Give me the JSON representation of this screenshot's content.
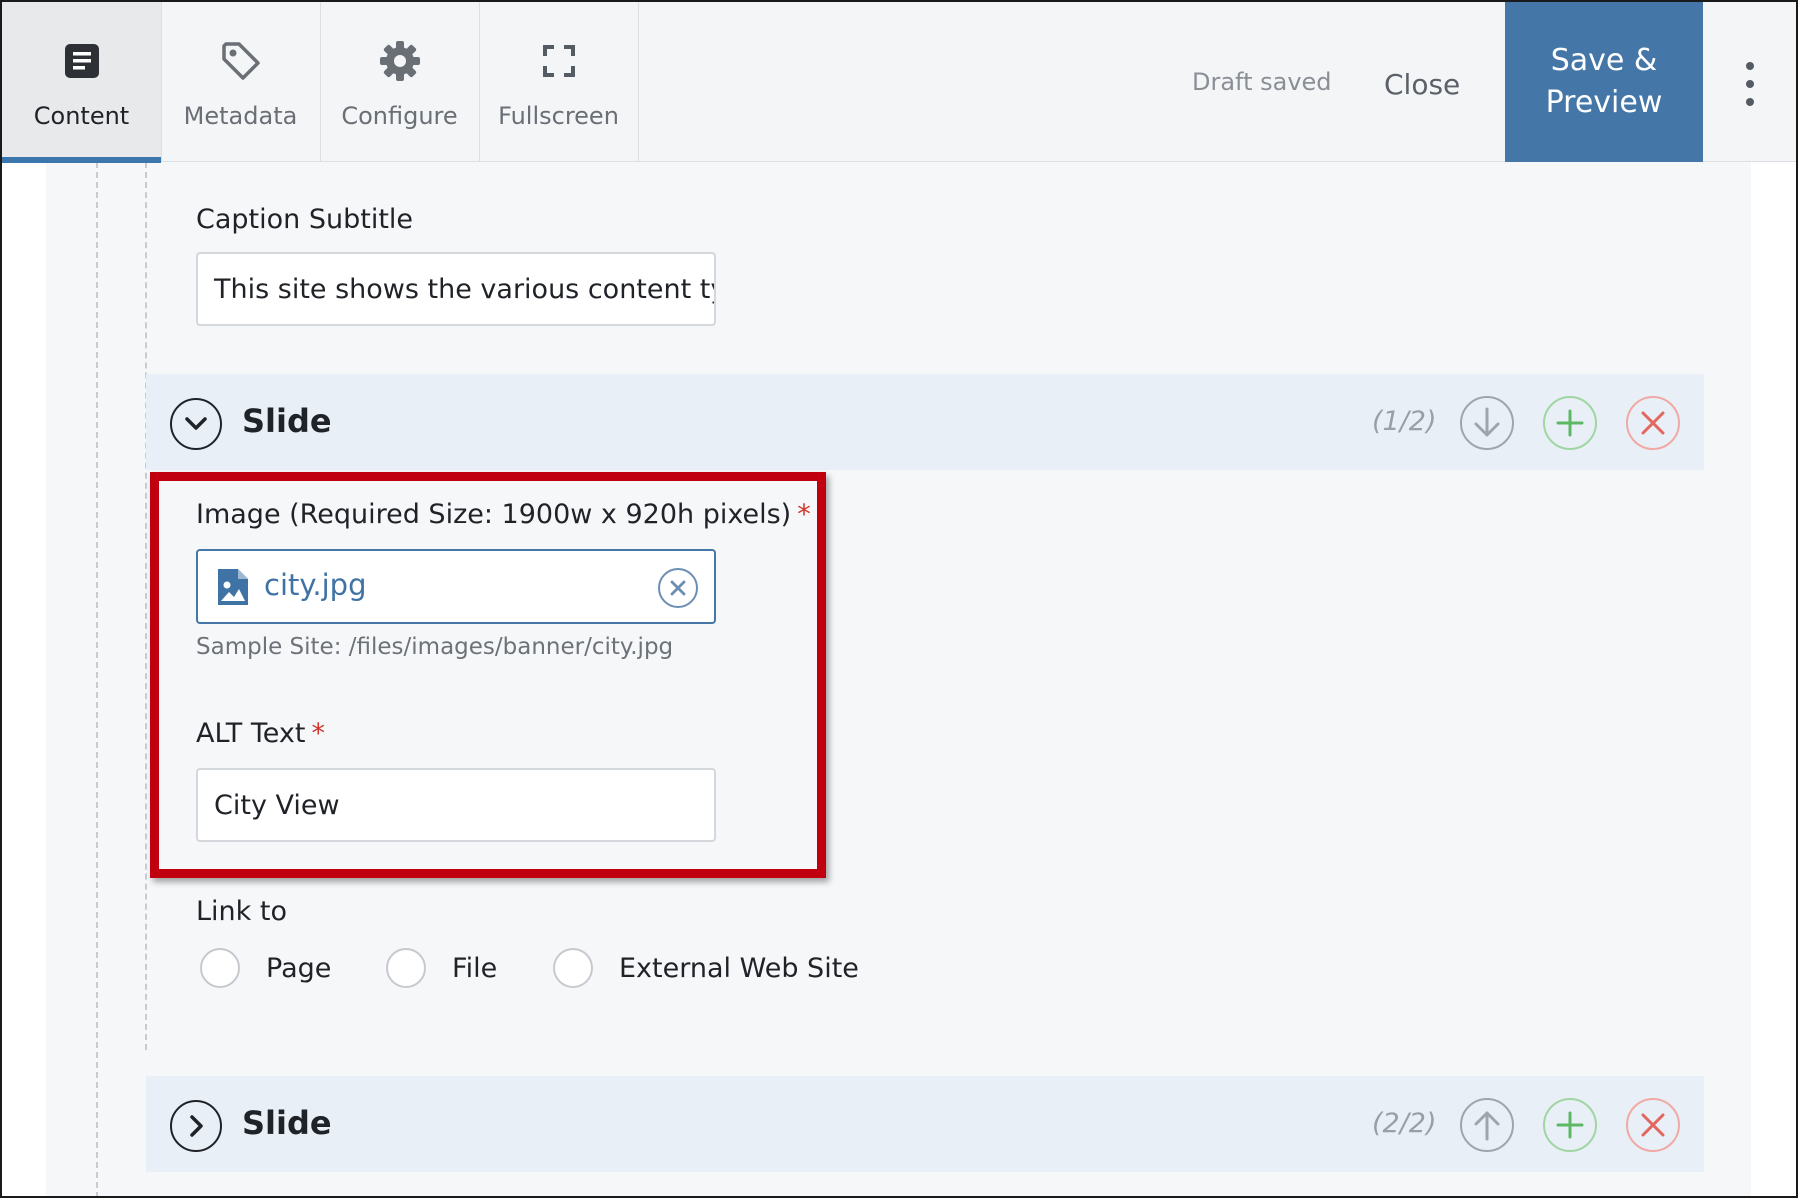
{
  "toolbar": {
    "tabs": [
      {
        "label": "Content",
        "icon": "content-icon",
        "active": true
      },
      {
        "label": "Metadata",
        "icon": "tag-icon",
        "active": false
      },
      {
        "label": "Configure",
        "icon": "gear-icon",
        "active": false
      },
      {
        "label": "Fullscreen",
        "icon": "fullscreen-icon",
        "active": false
      }
    ],
    "draft_status": "Draft saved",
    "close_label": "Close",
    "save_label": "Save & Preview",
    "more_icon": "kebab-menu-icon"
  },
  "form": {
    "caption_subtitle": {
      "label": "Caption Subtitle",
      "value": "This site shows the various content types"
    },
    "slides": [
      {
        "title": "Slide",
        "count": "(1/2)",
        "expanded": true,
        "image": {
          "label": "Image (Required Size: 1900w x 920h pixels)",
          "required_mark": "*",
          "file_name": "city.jpg",
          "path_hint": "Sample Site: /files/images/banner/city.jpg"
        },
        "alt_text": {
          "label": "ALT Text",
          "required_mark": "*",
          "value": "City View"
        },
        "link_to": {
          "label": "Link to",
          "options": [
            "Page",
            "File",
            "External Web Site"
          ]
        }
      },
      {
        "title": "Slide",
        "count": "(2/2)",
        "expanded": false
      }
    ]
  },
  "colors": {
    "accent": "#4477a7",
    "highlight": "#c0000f",
    "required": "#d0342c",
    "add": "#5cb865",
    "delete": "#e2675f"
  }
}
